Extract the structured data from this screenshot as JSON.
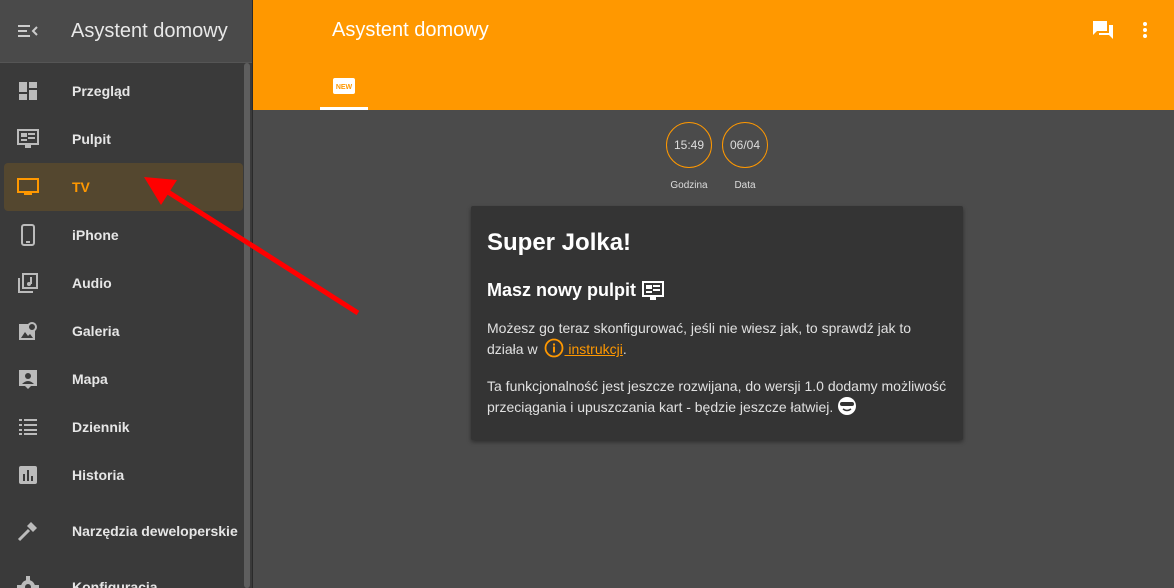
{
  "sidebar": {
    "title": "Asystent domowy",
    "items": [
      {
        "label": "Przegląd",
        "icon": "dashboard-icon"
      },
      {
        "label": "Pulpit",
        "icon": "monitor-dashboard-icon"
      },
      {
        "label": "TV",
        "icon": "tv-icon",
        "active": true
      },
      {
        "label": "iPhone",
        "icon": "phone-icon"
      },
      {
        "label": "Audio",
        "icon": "music-library-icon"
      },
      {
        "label": "Galeria",
        "icon": "image-search-icon"
      },
      {
        "label": "Mapa",
        "icon": "account-box-icon"
      },
      {
        "label": "Dziennik",
        "icon": "format-list-icon"
      },
      {
        "label": "Historia",
        "icon": "poll-box-icon"
      },
      {
        "label": "Narzędzia deweloperskie",
        "icon": "hammer-icon"
      },
      {
        "label": "Konfiguracja",
        "icon": "cog-icon"
      }
    ]
  },
  "header": {
    "title": "Asystent domowy",
    "tab_label": "NEW"
  },
  "badges": [
    {
      "value": "15:49",
      "caption": "Godzina"
    },
    {
      "value": "06/04",
      "caption": "Data"
    }
  ],
  "card": {
    "title": "Super Jolka!",
    "subtitle": "Masz nowy pulpit",
    "p1_a": "Możesz go teraz skonfigurować, jeśli nie wiesz jak, to sprawdź jak to działa w",
    "p1_link": " instrukcji",
    "p1_end": ".",
    "p2": "Ta funkcjonalność jest jeszcze rozwijana, do wersji 1.0 dodamy możliwość przeciągania i upuszczania kart - będzie jeszcze łatwiej."
  },
  "colors": {
    "accent": "#ff9800",
    "sidebar": "#3a3a3a",
    "main": "#4b4b4b",
    "card": "#343434",
    "arrow": "#ff0000"
  }
}
